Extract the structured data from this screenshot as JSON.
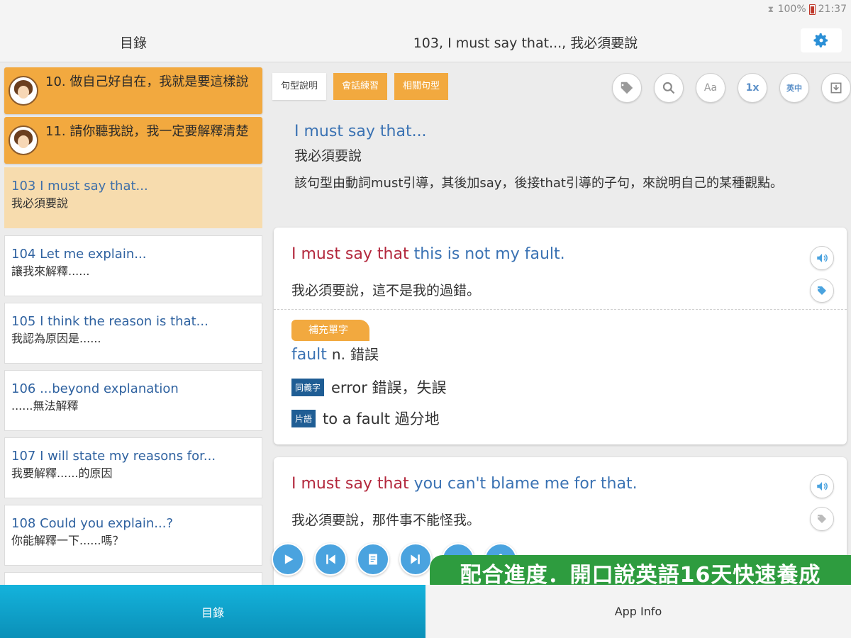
{
  "status": {
    "battery": "100%",
    "time": "21:37"
  },
  "header": {
    "left_title": "目錄",
    "main_title": "103, I must say that..., 我必須要說"
  },
  "sidebar": {
    "chapters": [
      {
        "label": "10. 做自己好自在，我就是要這樣說"
      },
      {
        "label": "11. 請你聽我說，我一定要解釋清楚"
      }
    ],
    "items": [
      {
        "en": "103  I must say that...",
        "zh": "我必須要說",
        "selected": true
      },
      {
        "en": "104  Let me explain...",
        "zh": "讓我來解釋......"
      },
      {
        "en": "105  I think the reason is that...",
        "zh": "我認為原因是......"
      },
      {
        "en": "106  ...beyond explanation",
        "zh": "......無法解釋"
      },
      {
        "en": "107  I will state my reasons for...",
        "zh": "我要解釋......的原因"
      },
      {
        "en": "108  Could you explain...?",
        "zh": "你能解釋一下......嗎？"
      }
    ]
  },
  "tabs": [
    {
      "label": "句型說明",
      "active": true
    },
    {
      "label": "會話練習",
      "active": false
    },
    {
      "label": "相關句型",
      "active": false
    }
  ],
  "tools": {
    "tag": "tag-icon",
    "search": "search-icon",
    "font": "Aa",
    "speed": "1x",
    "lang": "英中",
    "download": "download-icon"
  },
  "pattern": {
    "en": "I must say that...",
    "zh": "我必須要說",
    "desc": "該句型由動詞must引導，其後加say，後接that引導的子句，來說明自己的某種觀點。"
  },
  "examples": [
    {
      "en_highlight": "I must say that",
      "en_rest": " this is not my fault.",
      "zh": "我必須要說，這不是我的過錯。",
      "badge": "補充單字",
      "vocab_word": "fault",
      "vocab_pos": "n.",
      "vocab_def": "錯誤",
      "synonym_tag": "同義字",
      "synonym_text": "error 錯誤，失誤",
      "phrase_tag": "片語",
      "phrase_text": "to a fault 過分地"
    },
    {
      "en_highlight": "I must say that",
      "en_rest": " you can't blame me for that.",
      "zh": "我必須要說，那件事不能怪我。"
    }
  ],
  "promo": "配合進度．開口說英語16天快速養成",
  "bottom_nav": [
    {
      "label": "目錄",
      "active": true
    },
    {
      "label": "App Info",
      "active": false
    }
  ],
  "colors": {
    "orange": "#f2a93f",
    "blue_text": "#3a72b3",
    "red_highlight": "#b3283d",
    "nav_blue": "#14b3dc",
    "promo_green": "#2e9c3f"
  }
}
